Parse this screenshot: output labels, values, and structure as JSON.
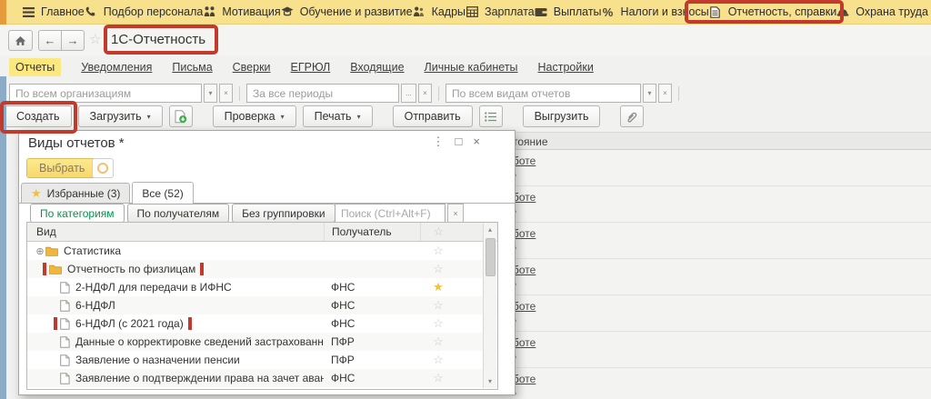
{
  "icons": {
    "caret": "▾",
    "close_x": "×",
    "kebab": "⋮",
    "maximize": "□",
    "star_filled": "★",
    "star_outline": "☆",
    "expand_plus": "⊕",
    "arrow_left": "←",
    "arrow_right": "→",
    "scroll_up": "▴",
    "scroll_down": "▾",
    "chevron": "›",
    "percent": "%",
    "range_dots": "...",
    "clear_x": "×"
  },
  "menu": {
    "items": [
      {
        "label": "Главное",
        "icon": "hamburger-icon"
      },
      {
        "label": "Подбор персонала",
        "icon": "phone-icon"
      },
      {
        "label": "Мотивация",
        "icon": "motivation-icon"
      },
      {
        "label": "Обучение и развитие",
        "icon": "education-icon"
      },
      {
        "label": "Кадры",
        "icon": "staff-icon"
      },
      {
        "label": "Зарплата",
        "icon": "salary-icon"
      },
      {
        "label": "Выплаты",
        "icon": "payments-icon"
      },
      {
        "label": "Налоги и взносы",
        "icon": "taxes-icon"
      },
      {
        "label": "Отчетность, справки",
        "icon": "reporting-icon"
      },
      {
        "label": "Охрана труда",
        "icon": "safety-icon"
      }
    ]
  },
  "navbar": {
    "page_title": "1С-Отчетность"
  },
  "section_tabs": {
    "items": [
      "Отчеты",
      "Уведомления",
      "Письма",
      "Сверки",
      "ЕГРЮЛ",
      "Входящие",
      "Личные кабинеты",
      "Настройки"
    ]
  },
  "filters": {
    "organization": "По всем организациям",
    "period": "За все периоды",
    "report_kind": "По всем видам отчетов"
  },
  "toolbar": {
    "create": "Создать",
    "load": "Загрузить",
    "check": "Проверка",
    "print": "Печать",
    "send": "Отправить",
    "export": "Выгрузить"
  },
  "dialog": {
    "title": "Виды отчетов *",
    "select_button": "Выбрать",
    "tabs": {
      "favorites": "Избранные (3)",
      "all": "Все (52)"
    },
    "group_buttons": {
      "by_category": "По категориям",
      "by_recipient": "По получателям",
      "no_grouping": "Без группировки"
    },
    "search_placeholder": "Поиск (Ctrl+Alt+F)",
    "columns": {
      "kind": "Вид",
      "recipient": "Получатель"
    },
    "rows": [
      {
        "type": "folder",
        "label": "Статистика",
        "recipient": ""
      },
      {
        "type": "folder",
        "label": "Отчетность по физлицам",
        "recipient": ""
      },
      {
        "type": "doc",
        "label": "2-НДФЛ для передачи в ИФНС",
        "recipient": "ФНС"
      },
      {
        "type": "doc",
        "label": "6-НДФЛ",
        "recipient": "ФНС"
      },
      {
        "type": "doc",
        "label": "6-НДФЛ (с 2021 года)",
        "recipient": "ФНС"
      },
      {
        "type": "doc",
        "label": "Данные о корректировке сведений застрахованных лиц. СЗВ-КОРР",
        "recipient": "ПФР"
      },
      {
        "type": "doc",
        "label": "Заявление о назначении пенсии",
        "recipient": "ПФР"
      },
      {
        "type": "doc",
        "label": "Заявление о подтверждении права на зачет авансов по НДФЛ",
        "recipient": "ФНС"
      }
    ]
  },
  "background_list": {
    "header_partial": "тояние",
    "row_link_partial": "боте"
  }
}
